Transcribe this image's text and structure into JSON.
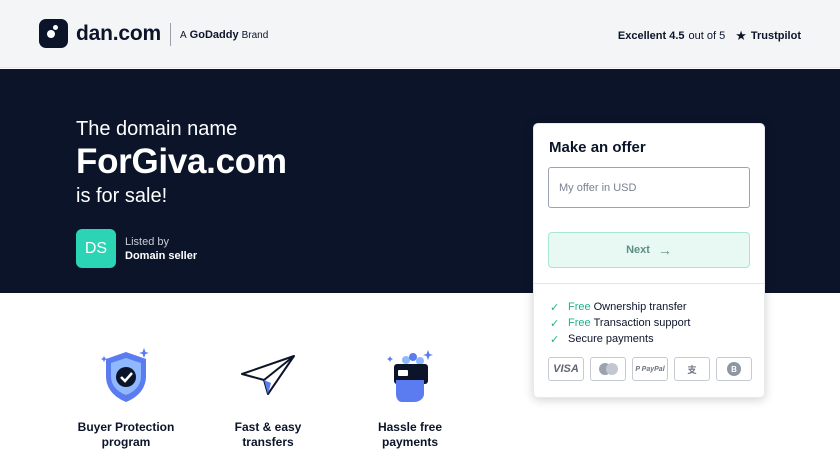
{
  "header": {
    "logo_text": "dan.com",
    "brand_prefix": "A",
    "brand_name": "GoDaddy",
    "brand_suffix": "Brand",
    "rating_label": "Excellent 4.5",
    "rating_suffix": "out of 5",
    "trust_star": "★",
    "trust_name": "Trustpilot"
  },
  "hero": {
    "line1": "The domain name",
    "domain": "ForGiva.com",
    "line3": "is for sale!",
    "seller_initials": "DS",
    "listed_by_label": "Listed by",
    "seller_name": "Domain seller"
  },
  "offer": {
    "title": "Make an offer",
    "input_placeholder": "My offer in USD",
    "input_value": "",
    "next_label": "Next",
    "next_arrow": "→",
    "benefits": [
      {
        "free": "Free",
        "text": "Ownership transfer"
      },
      {
        "free": "Free",
        "text": "Transaction support"
      },
      {
        "free": "",
        "text": "Secure payments"
      }
    ],
    "payment_methods": {
      "visa": "VISA",
      "paypal": "P PayPal",
      "alipay": "支",
      "bitcoin": "B"
    }
  },
  "features": [
    {
      "icon": "shield-check-icon",
      "label": "Buyer Protection program"
    },
    {
      "icon": "paper-plane-icon",
      "label": "Fast & easy transfers"
    },
    {
      "icon": "hand-card-icon",
      "label": "Hassle free payments"
    }
  ],
  "colors": {
    "navy": "#0b1429",
    "accent": "#1cb48c",
    "seller_badge": "#2bd4b5"
  }
}
